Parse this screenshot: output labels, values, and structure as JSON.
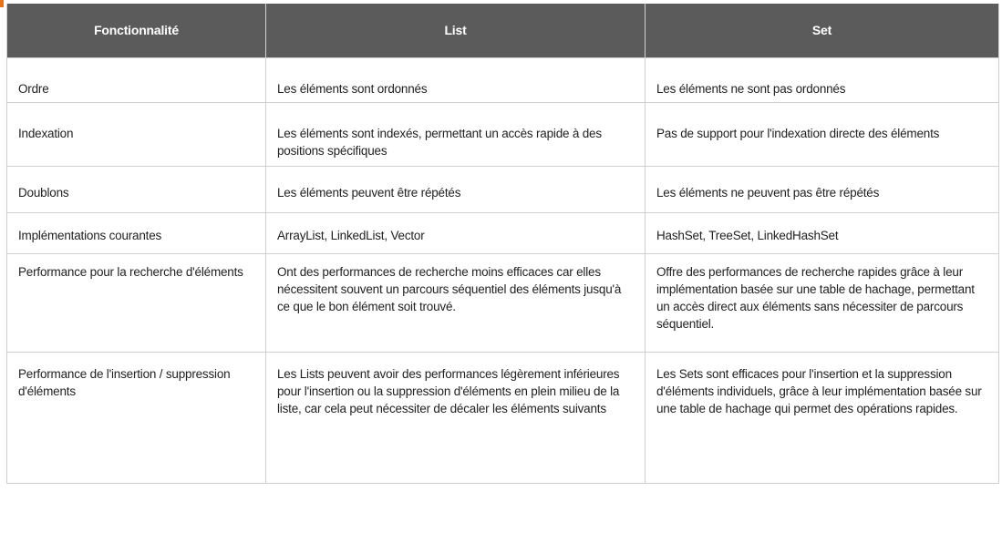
{
  "table": {
    "headers": [
      "Fonctionnalité",
      "List",
      "Set"
    ],
    "rows": [
      {
        "feature": "Ordre",
        "list": "Les éléments sont ordonnés",
        "set": "Les éléments ne sont pas ordonnés"
      },
      {
        "feature": "Indexation",
        "list": "Les éléments sont indexés, permettant un accès rapide à des positions spécifiques",
        "set": "Pas de support pour l'indexation directe des éléments"
      },
      {
        "feature": "Doublons",
        "list": "Les éléments peuvent être répétés",
        "set": "Les éléments ne peuvent pas être répétés"
      },
      {
        "feature": "Implémentations courantes",
        "list": "ArrayList, LinkedList, Vector",
        "set": "HashSet, TreeSet, LinkedHashSet"
      },
      {
        "feature": "Performance pour la recherche d'éléments",
        "list": "Ont  des performances de recherche moins efficaces car elles nécessitent souvent un parcours séquentiel des éléments jusqu'à ce que le bon élément soit trouvé.",
        "set": "Offre des performances de recherche rapides grâce à leur implémentation basée sur une table de hachage, permettant un accès direct aux éléments sans nécessiter de parcours séquentiel."
      },
      {
        "feature": "Performance de l'insertion / suppression d'éléments",
        "list": "Les Lists peuvent avoir des performances légèrement inférieures pour l'insertion ou la suppression d'éléments en plein milieu de la liste, car cela peut nécessiter de décaler les éléments suivants",
        "set": "Les Sets sont efficaces pour l'insertion et la suppression d'éléments individuels, grâce à leur implémentation basée sur une table de hachage qui permet des opérations rapides."
      }
    ]
  },
  "colors": {
    "header_bg": "#5b5b5b",
    "header_text": "#ffffff",
    "border": "#cfcfcf",
    "accent_mark": "#e8731c"
  }
}
